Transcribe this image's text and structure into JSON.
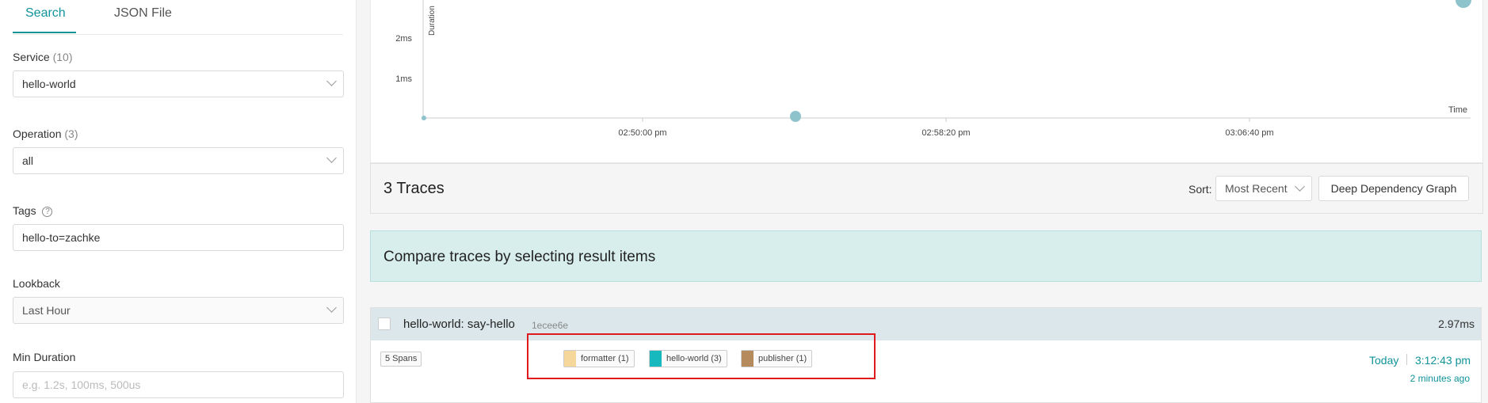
{
  "search_tabs": {
    "search": "Search",
    "json_file": "JSON File"
  },
  "form": {
    "service": {
      "label": "Service",
      "count": "(10)",
      "value": "hello-world"
    },
    "operation": {
      "label": "Operation",
      "count": "(3)",
      "value": "all"
    },
    "tags": {
      "label": "Tags",
      "help": "?",
      "value": "hello-to=zachke"
    },
    "lookback": {
      "label": "Lookback",
      "value": "Last Hour"
    },
    "min_duration": {
      "label": "Min Duration",
      "placeholder": "e.g. 1.2s, 100ms, 500us"
    }
  },
  "scatter": {
    "y_axis_label": "Duration",
    "x_axis_label": "Time",
    "y_ticks": [
      "2ms",
      "1ms"
    ],
    "x_ticks": [
      "02:50:00 pm",
      "02:58:20 pm",
      "03:06:40 pm"
    ],
    "point_color": "#8ec3cc"
  },
  "results": {
    "title": "3 Traces",
    "sort_label": "Sort:",
    "sort_value": "Most Recent",
    "ddg_button": "Deep Dependency Graph"
  },
  "compare_banner": "Compare traces by selecting result items",
  "trace": {
    "name": "hello-world: say-hello",
    "id": "1ecee6e",
    "duration": "2.97ms",
    "spans": "5 Spans",
    "services": [
      {
        "label": "formatter (1)",
        "color": "#f5d69b"
      },
      {
        "label": "hello-world (3)",
        "color": "#17b8be"
      },
      {
        "label": "publisher (1)",
        "color": "#b58b5e"
      }
    ],
    "day": "Today",
    "time": "3:12:43 pm",
    "ago": "2 minutes ago"
  }
}
